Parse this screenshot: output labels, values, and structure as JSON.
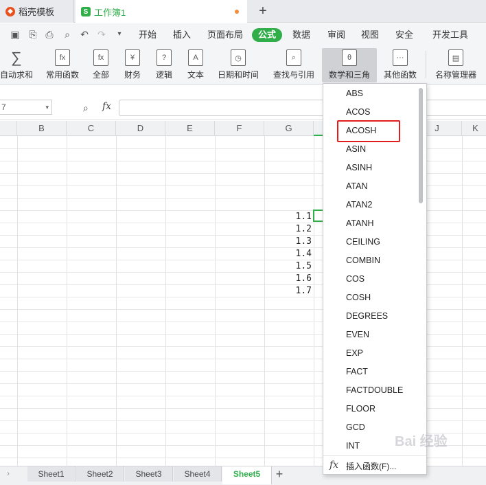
{
  "tabs": [
    {
      "label": "稻壳模板",
      "active": false
    },
    {
      "label": "工作簿1",
      "active": true
    }
  ],
  "menu": {
    "items": [
      "开始",
      "插入",
      "页面布局",
      "公式",
      "数据",
      "审阅",
      "视图",
      "安全",
      "开发工具"
    ],
    "active": "公式"
  },
  "ribbon": {
    "groups": [
      "自动求和",
      "常用函数",
      "全部",
      "财务",
      "逻辑",
      "文本",
      "日期和时间",
      "查找与引用",
      "数学和三角",
      "其他函数",
      "名称管理器"
    ],
    "active": "数学和三角"
  },
  "formula_bar": {
    "fx_label": "fx",
    "formula_value": ""
  },
  "columns": [
    "B",
    "C",
    "D",
    "E",
    "F",
    "G",
    "J",
    "K"
  ],
  "cell_values": [
    "1.1",
    "1.2",
    "1.3",
    "1.4",
    "1.5",
    "1.6",
    "1.7"
  ],
  "dropdown": {
    "items": [
      "ABS",
      "ACOS",
      "ACOSH",
      "ASIN",
      "ASINH",
      "ATAN",
      "ATAN2",
      "ATANH",
      "CEILING",
      "COMBIN",
      "COS",
      "COSH",
      "DEGREES",
      "EVEN",
      "EXP",
      "FACT",
      "FACTDOUBLE",
      "FLOOR",
      "GCD",
      "INT"
    ],
    "highlighted": "ACOSH",
    "insert_function_label": "插入函数(F)..."
  },
  "sheets": {
    "tabs": [
      "Sheet1",
      "Sheet2",
      "Sheet3",
      "Sheet4",
      "Sheet5"
    ],
    "active": "Sheet5"
  },
  "colors": {
    "accent_green": "#2fae4a",
    "highlight_red": "#e21d1d"
  },
  "watermark": "Bai 经验"
}
